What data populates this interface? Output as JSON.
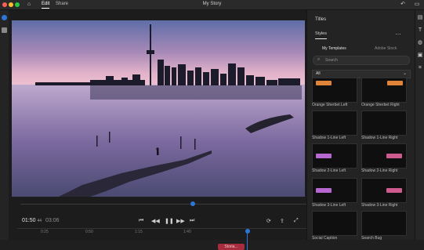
{
  "topbar": {
    "nav": [
      {
        "label": "Edit"
      },
      {
        "label": "Share"
      }
    ],
    "doc_title": "My Story"
  },
  "panel": {
    "title": "Titles",
    "tabs": [
      {
        "label": "Styles"
      }
    ],
    "subtabs": [
      {
        "label": "My Templates"
      },
      {
        "label": "Adobe Stock"
      }
    ],
    "search_placeholder": "Search",
    "filter_value": "All",
    "thumbnails": [
      {
        "label": "Orange Sherbet Left"
      },
      {
        "label": "Orange Sherbet Right"
      },
      {
        "label": "Shadow 1-Line Left"
      },
      {
        "label": "Shadow 1-Line Right"
      },
      {
        "label": "Shadow 2-Line Left"
      },
      {
        "label": "Shadow 2-Line Right"
      },
      {
        "label": "Shadow 3-Line Left"
      },
      {
        "label": "Shadow 3-Line Right"
      },
      {
        "label": "Social Caption"
      },
      {
        "label": "Search Bug"
      }
    ]
  },
  "player": {
    "current_time": "01:50",
    "current_frame": "44",
    "duration": "03:06"
  },
  "timeline": {
    "ruler": [
      "0:25",
      "0:50",
      "1:15",
      "1:40"
    ],
    "clip_label": "Storia...",
    "playhead_progress": 0.6
  },
  "colors": {
    "accent": "#2b76d6",
    "clip": "#a62c3e",
    "orange": "#e0843a",
    "purple": "#b667d0",
    "pink": "#cf5a8f"
  },
  "icons": {
    "home": "home-icon",
    "undo": "undo-icon",
    "comment": "comment-icon",
    "play": "play-icon",
    "pause": "pause-icon",
    "step_back": "step-back-icon",
    "step_forward": "step-forward-icon",
    "skip_start": "skip-start-icon",
    "skip_end": "skip-end-icon",
    "fullscreen": "fullscreen-icon",
    "more": "more-icon",
    "search": "search-icon"
  }
}
